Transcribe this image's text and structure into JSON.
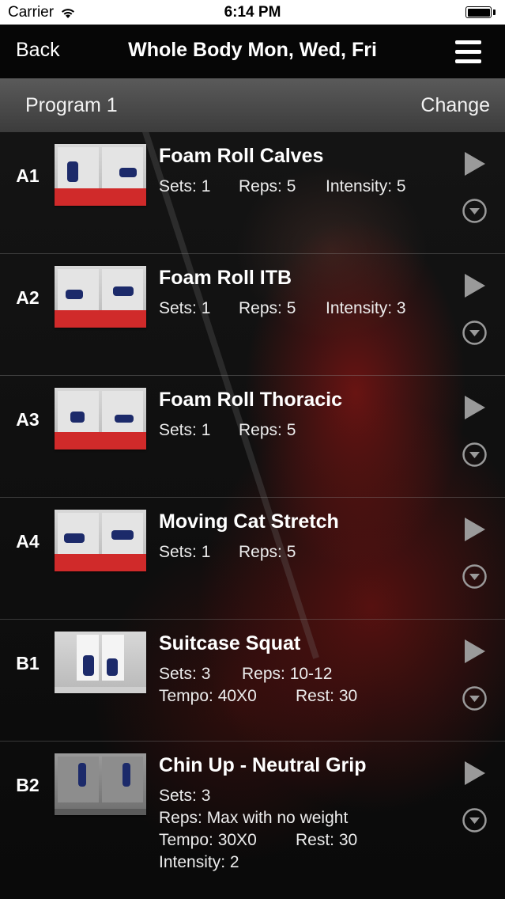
{
  "status_bar": {
    "carrier": "Carrier",
    "time": "6:14 PM",
    "wifi_icon": "wifi-icon",
    "battery_icon": "battery-icon"
  },
  "nav": {
    "back_label": "Back",
    "title": "Whole Body Mon, Wed, Fri",
    "menu_icon": "hamburger-menu-icon"
  },
  "program": {
    "name": "Program 1",
    "change_label": "Change"
  },
  "exercises": [
    {
      "code": "A1",
      "name": "Foam Roll Calves",
      "sets": "Sets: 1",
      "reps": "Reps: 5",
      "intensity": "Intensity: 5"
    },
    {
      "code": "A2",
      "name": "Foam Roll ITB",
      "sets": "Sets: 1",
      "reps": "Reps: 5",
      "intensity": "Intensity: 3"
    },
    {
      "code": "A3",
      "name": "Foam Roll Thoracic",
      "sets": "Sets: 1",
      "reps": "Reps: 5"
    },
    {
      "code": "A4",
      "name": "Moving Cat Stretch",
      "sets": "Sets: 1",
      "reps": "Reps: 5"
    },
    {
      "code": "B1",
      "name": "Suitcase Squat",
      "sets": "Sets: 3",
      "reps": "Reps: 10-12",
      "tempo": "Tempo: 40X0",
      "rest": "Rest: 30"
    },
    {
      "code": "B2",
      "name": "Chin Up - Neutral Grip",
      "sets": "Sets: 3",
      "reps": "Reps: Max with no weight",
      "tempo": "Tempo: 30X0",
      "rest": "Rest: 30",
      "intensity": "Intensity: 2"
    }
  ],
  "colors": {
    "nav_background": "#060606",
    "program_bar": "#4a4a4a",
    "icon_grey": "#9a9a9a"
  }
}
